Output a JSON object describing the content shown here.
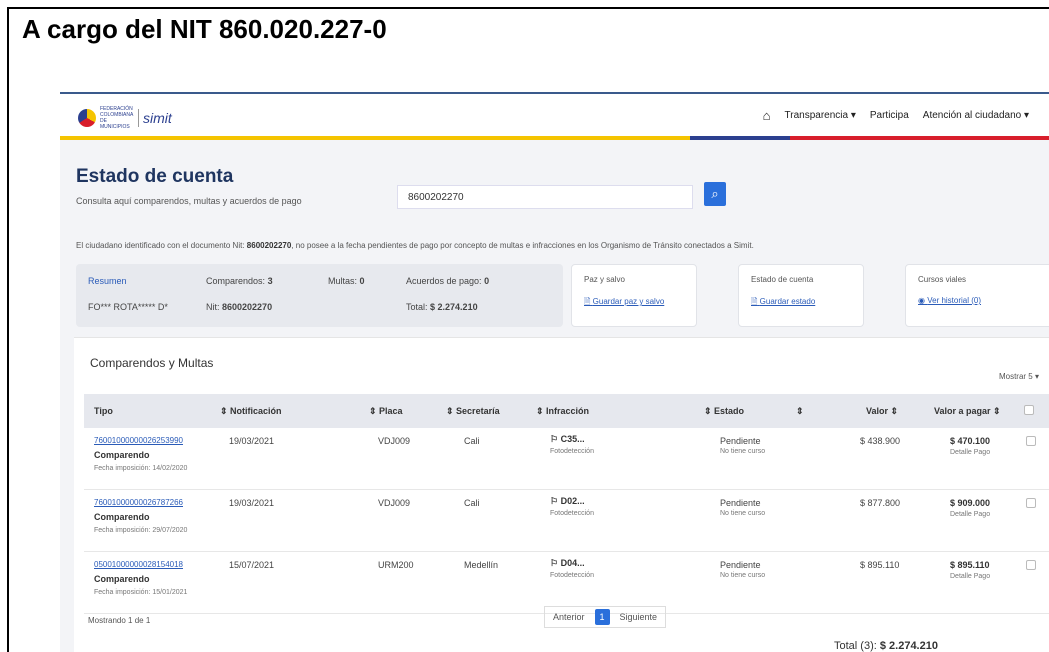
{
  "heading": "A cargo del NIT 860.020.227-0",
  "header": {
    "logo_text": "FEDERACIÓN COLOMBIANA DE MUNICIPIOS",
    "logo_simit": "simit",
    "nav": [
      "Transparencia ▾",
      "Participa",
      "Atención al ciudadano ▾"
    ]
  },
  "page": {
    "title": "Estado de cuenta",
    "subtitle": "Consulta aquí comparendos, multas y acuerdos de pago",
    "search_value": "8600202270",
    "notice_pre": "El ciudadano identificado con el documento Nit:",
    "notice_doc": "8600202270",
    "notice_post": ", no posee a la fecha pendientes de pago por concepto de multas e infracciones en los Organismo de Tránsito conectados a Simit."
  },
  "summary": {
    "resumen": "Resumen",
    "name": "FO*** ROTA***** D*",
    "comparendos_label": "Comparendos:",
    "comparendos_value": "3",
    "nit_label": "Nit:",
    "nit_value": "8600202270",
    "multas_label": "Multas:",
    "multas_value": "0",
    "acuerdos_label": "Acuerdos de pago:",
    "acuerdos_value": "0",
    "total_label": "Total:",
    "total_value": "$ 2.274.210"
  },
  "cards": [
    {
      "title": "Paz y salvo",
      "link": "Guardar paz y salvo"
    },
    {
      "title": "Estado de cuenta",
      "link": "Guardar estado"
    },
    {
      "title": "Cursos viales",
      "link": "Ver historial (0)"
    }
  ],
  "table": {
    "title": "Comparendos y Multas",
    "mostrar": "Mostrar  5  ▾",
    "headers": [
      "Tipo",
      "Notificación",
      "Placa",
      "Secretaría",
      "Infracción",
      "Estado",
      "Valor",
      "Valor a pagar"
    ],
    "rows": [
      {
        "id": "76001000000026253990",
        "tipo": "Comparendo",
        "fecha": "Fecha imposición: 14/02/2020",
        "notificacion": "19/03/2021",
        "placa": "VDJ009",
        "secretaria": "Cali",
        "infraccion": "C35...",
        "infraccion_sub": "Fotodetección",
        "estado": "Pendiente",
        "estado_sub": "No tiene curso",
        "valor": "$ 438.900",
        "valor_pagar": "$ 470.100",
        "detalle": "Detalle Pago"
      },
      {
        "id": "76001000000026787266",
        "tipo": "Comparendo",
        "fecha": "Fecha imposición: 29/07/2020",
        "notificacion": "19/03/2021",
        "placa": "VDJ009",
        "secretaria": "Cali",
        "infraccion": "D02...",
        "infraccion_sub": "Fotodetección",
        "estado": "Pendiente",
        "estado_sub": "No tiene curso",
        "valor": "$ 877.800",
        "valor_pagar": "$ 909.000",
        "detalle": "Detalle Pago"
      },
      {
        "id": "05001000000028154018",
        "tipo": "Comparendo",
        "fecha": "Fecha imposición: 15/01/2021",
        "notificacion": "15/07/2021",
        "placa": "URM200",
        "secretaria": "Medellín",
        "infraccion": "D04...",
        "infraccion_sub": "Fotodetección",
        "estado": "Pendiente",
        "estado_sub": "No tiene curso",
        "valor": "$ 895.110",
        "valor_pagar": "$ 895.110",
        "detalle": "Detalle Pago"
      }
    ],
    "mostrando": "Mostrando 1 de 1",
    "pager": {
      "prev": "Anterior",
      "current": "1",
      "next": "Siguiente"
    },
    "total_label": "Total (3):",
    "total_value": "$ 2.274.210"
  }
}
